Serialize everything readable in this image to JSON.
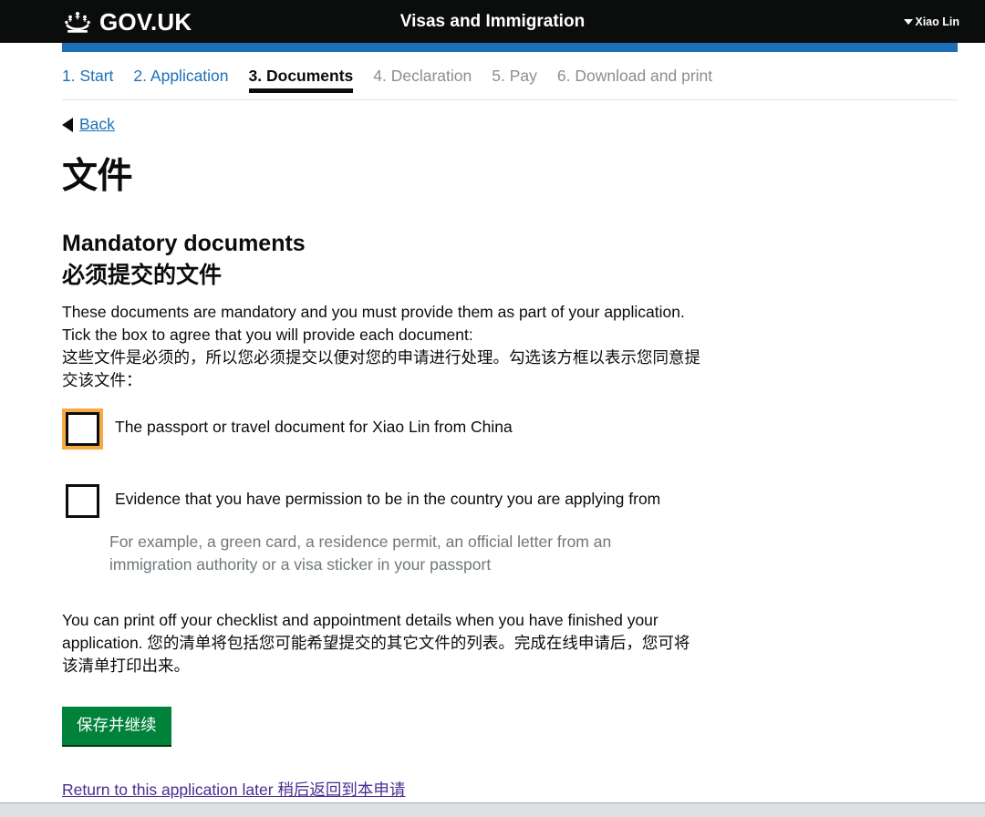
{
  "header": {
    "brand": "GOV.UK",
    "crown_icon": "crown-icon",
    "service_name": "Visas and Immigration",
    "account_name": "Xiao Lin",
    "account_caret_icon": "caret-down-icon"
  },
  "steps": [
    {
      "label": "1. Start",
      "state": "done"
    },
    {
      "label": "2. Application",
      "state": "done"
    },
    {
      "label": "3. Documents",
      "state": "active"
    },
    {
      "label": "4. Declaration",
      "state": "future"
    },
    {
      "label": "5. Pay",
      "state": "future"
    },
    {
      "label": "6. Download and print",
      "state": "future"
    }
  ],
  "back": {
    "label": "Back",
    "arrow_icon": "triangle-left-icon"
  },
  "main": {
    "page_title": "文件",
    "section_heading_en": "Mandatory documents",
    "section_heading_cn": "必须提交的文件",
    "intro_en": "These documents are mandatory and you must provide them as part of your application. Tick the box to agree that you will provide each document:",
    "intro_cn": "这些文件是必须的，所以您必须提交以便对您的申请进行处理。勾选该方框以表示您同意提交该文件：",
    "checkboxes": [
      {
        "label": "The passport or travel document for Xiao Lin from China",
        "checked": false,
        "focused": true,
        "hint": ""
      },
      {
        "label": "Evidence that you have permission to be in the country you are applying from",
        "checked": false,
        "focused": false,
        "hint": "For example, a green card, a residence permit, an official letter from an immigration authority or a visa sticker in your passport"
      }
    ],
    "closing_en": "You can print off your checklist and appointment details when you have finished your application.",
    "closing_cn": "您的清单将包括您可能希望提交的其它文件的列表。完成在线申请后，您可将该清单打印出来。",
    "save_button": "保存并继续",
    "return_link": "Return to this application later 稍后返回到本申请"
  },
  "colors": {
    "header_black": "#0b0c0c",
    "progress_blue": "#1d70b8",
    "link_blue": "#1d70b8",
    "visited_purple": "#4c2c92",
    "focus_orange": "#f7aa42",
    "button_green": "#00823b",
    "hint_grey": "#6f777b",
    "future_step_grey": "#8a8e91"
  }
}
